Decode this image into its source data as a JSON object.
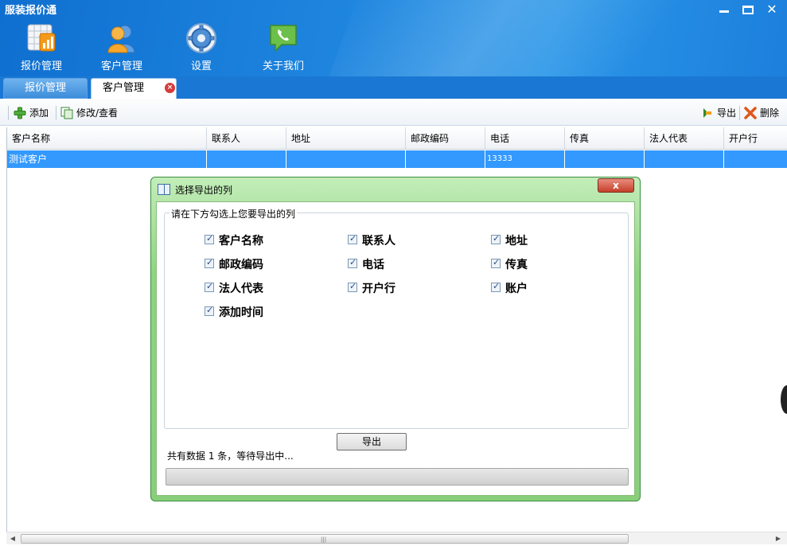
{
  "app": {
    "title": "服装报价通"
  },
  "window_controls": {
    "minimize": "minimize",
    "maximize": "maximize",
    "close": "✕"
  },
  "nav": {
    "items": [
      {
        "label": "报价管理",
        "icon": "chart-grid-icon"
      },
      {
        "label": "客户管理",
        "icon": "users-icon"
      },
      {
        "label": "设置",
        "icon": "gear-icon"
      },
      {
        "label": "关于我们",
        "icon": "phone-chat-icon"
      }
    ]
  },
  "tabs": [
    {
      "label": "报价管理"
    },
    {
      "label": "客户管理",
      "close": "×"
    }
  ],
  "toolbar": {
    "add_label": "添加",
    "edit_label": "修改/查看",
    "export_label": "导出",
    "delete_label": "删除"
  },
  "grid": {
    "columns": [
      "客户名称",
      "联系人",
      "地址",
      "邮政编码",
      "电话",
      "传真",
      "法人代表",
      "开户行"
    ],
    "rows": [
      [
        "测试客户",
        "",
        "",
        "",
        "13333",
        "",
        "",
        ""
      ]
    ]
  },
  "dialog": {
    "title": "选择导出的列",
    "close_label": "x",
    "group_label": "请在下方勾选上您要导出的列",
    "options": [
      {
        "label": "客户名称",
        "checked": true
      },
      {
        "label": "联系人",
        "checked": true
      },
      {
        "label": "地址",
        "checked": true
      },
      {
        "label": "邮政编码",
        "checked": true
      },
      {
        "label": "电话",
        "checked": true
      },
      {
        "label": "传真",
        "checked": true
      },
      {
        "label": "法人代表",
        "checked": true
      },
      {
        "label": "开户行",
        "checked": true
      },
      {
        "label": "账户",
        "checked": true
      },
      {
        "label": "添加时间",
        "checked": true
      }
    ],
    "export_button": "导出",
    "status_prefix": "共有数据 1 条",
    "status_suffix": "，等待导出中...",
    "progress": 0
  },
  "colors": {
    "header_blue": "#1a78d4",
    "selection_blue": "#3399ff",
    "dialog_green": "#8fd481",
    "close_red": "#c5412b"
  }
}
